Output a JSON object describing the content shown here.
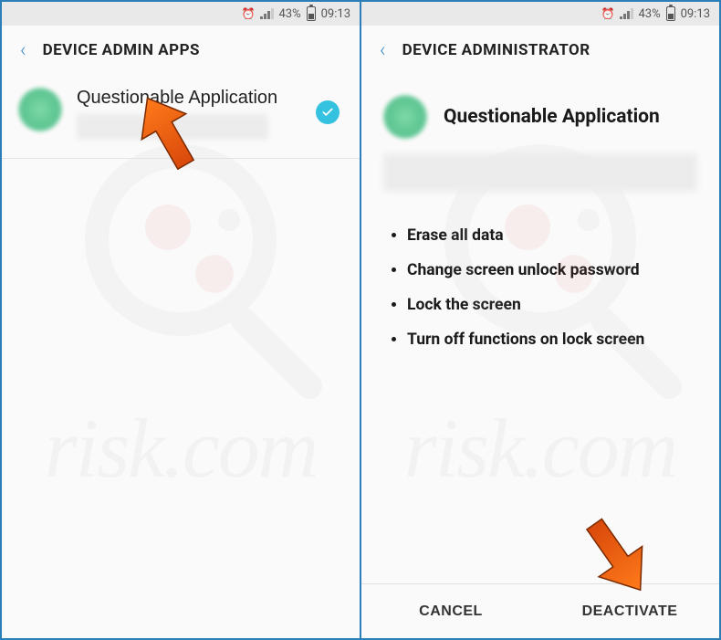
{
  "status": {
    "battery_pct": "43%",
    "time": "09:13"
  },
  "screen1": {
    "title": "DEVICE ADMIN APPS",
    "app_name": "Questionable Application"
  },
  "screen2": {
    "title": "DEVICE ADMINISTRATOR",
    "app_name": "Questionable Application",
    "permissions": [
      "Erase all data",
      "Change screen unlock password",
      "Lock the screen",
      "Turn off functions on lock screen"
    ],
    "cancel_label": "CANCEL",
    "deactivate_label": "DEACTIVATE"
  },
  "watermark_text": "risk.com"
}
